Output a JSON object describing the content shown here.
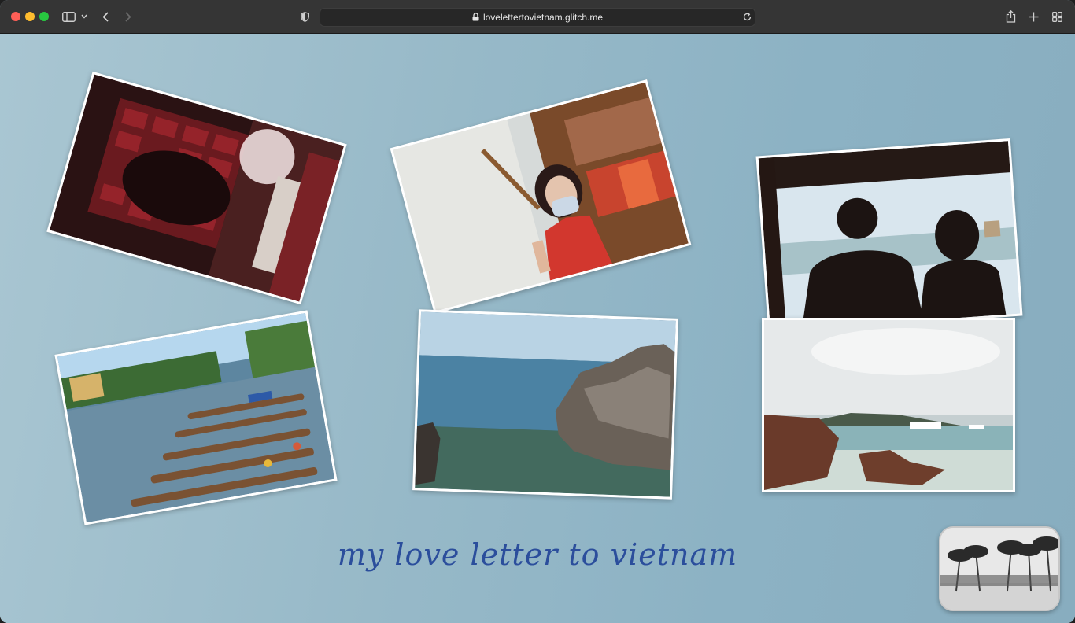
{
  "browser": {
    "url": "loveletter to vietnam.glitch.me",
    "url_display": "lovelettertovietnam.glitch.me",
    "icons": [
      "sidebar-icon",
      "chevron-down-icon",
      "back-icon",
      "forward-icon",
      "shield-icon",
      "lock-icon",
      "reload-icon",
      "share-icon",
      "new-tab-icon",
      "tab-overview-icon"
    ]
  },
  "page": {
    "title": "my love letter to vietnam",
    "colors": {
      "title": "#2b4e9c",
      "background": "#97b9c8"
    }
  },
  "photos": [
    {
      "id": "photo-red-interior",
      "subject": "red patterned chair interior"
    },
    {
      "id": "photo-girl-red-shirt",
      "subject": "girl in red shirt with face mask"
    },
    {
      "id": "photo-silhouettes",
      "subject": "two silhouettes by the sea"
    },
    {
      "id": "photo-boats-river",
      "subject": "boats on river"
    },
    {
      "id": "photo-sea-rocks",
      "subject": "sea and rocks"
    },
    {
      "id": "photo-beach-rocks",
      "subject": "beach rocks with boats"
    }
  ],
  "music_thumbnail": {
    "subject": "palm trees beach black and white"
  }
}
